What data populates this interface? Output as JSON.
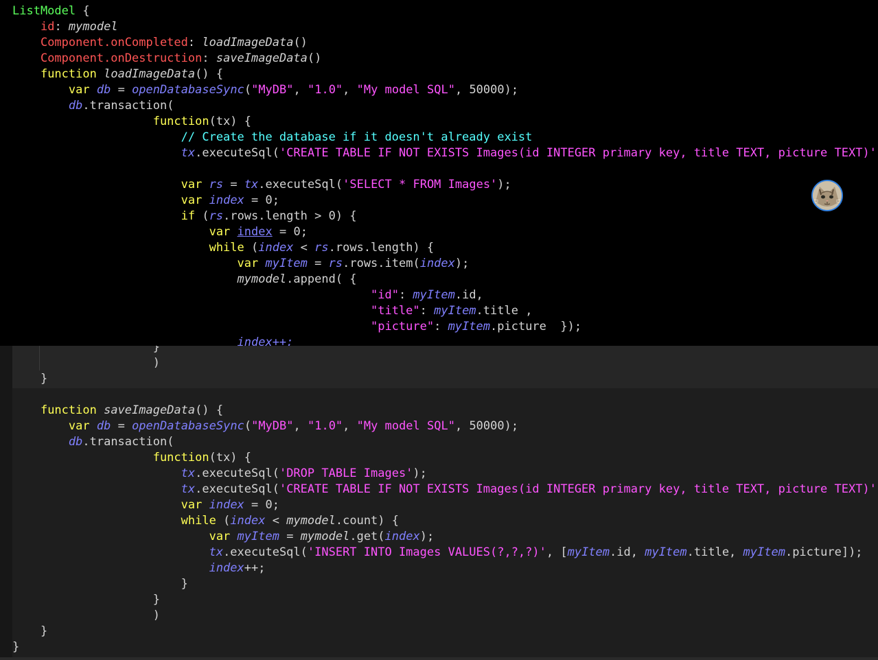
{
  "editor": {
    "top_lines": [
      [
        [
          "ListModel",
          "lg"
        ],
        [
          " {",
          "w"
        ]
      ],
      [
        [
          "    ",
          ""
        ],
        [
          "id",
          "red"
        ],
        [
          ": ",
          "w"
        ],
        [
          "mymodel",
          "w it"
        ]
      ],
      [
        [
          "    ",
          ""
        ],
        [
          "Component.onCompleted",
          "red"
        ],
        [
          ": ",
          "w"
        ],
        [
          "loadImageData",
          "w it"
        ],
        [
          "()",
          "w"
        ]
      ],
      [
        [
          "    ",
          ""
        ],
        [
          "Component.onDestruction",
          "red"
        ],
        [
          ": ",
          "w"
        ],
        [
          "saveImageData",
          "w it"
        ],
        [
          "()",
          "w"
        ]
      ],
      [
        [
          "    ",
          ""
        ],
        [
          "function",
          "kw"
        ],
        [
          " ",
          ""
        ],
        [
          "loadImageData",
          "w it"
        ],
        [
          "() {",
          "w"
        ]
      ],
      [
        [
          "        ",
          ""
        ],
        [
          "var",
          "kw"
        ],
        [
          " ",
          ""
        ],
        [
          "db",
          "prp it"
        ],
        [
          " = ",
          "w"
        ],
        [
          "openDatabaseSync",
          "prp it"
        ],
        [
          "(",
          "w"
        ],
        [
          "\"MyDB\"",
          "str"
        ],
        [
          ", ",
          "w"
        ],
        [
          "\"1.0\"",
          "str"
        ],
        [
          ", ",
          "w"
        ],
        [
          "\"My model SQL\"",
          "str"
        ],
        [
          ", ",
          "w"
        ],
        [
          "50000",
          "w"
        ],
        [
          ");",
          "w"
        ]
      ],
      [
        [
          "        ",
          ""
        ],
        [
          "db",
          "prp it"
        ],
        [
          ".transaction(",
          "w"
        ]
      ],
      [
        [
          "                    ",
          ""
        ],
        [
          "function",
          "kw"
        ],
        [
          "(tx) {",
          "w"
        ]
      ],
      [
        [
          "                        ",
          ""
        ],
        [
          "// Create the database if it doesn't already exist",
          "cm"
        ]
      ],
      [
        [
          "                        ",
          ""
        ],
        [
          "tx",
          "prp it"
        ],
        [
          ".executeSql(",
          "w"
        ],
        [
          "'CREATE TABLE IF NOT EXISTS Images(id INTEGER primary key, title TEXT, picture TEXT)'",
          "str"
        ],
        [
          ");",
          "w"
        ]
      ],
      [],
      [
        [
          "                        ",
          ""
        ],
        [
          "var",
          "kw"
        ],
        [
          " ",
          ""
        ],
        [
          "rs",
          "prp it"
        ],
        [
          " = ",
          "w"
        ],
        [
          "tx",
          "prp it"
        ],
        [
          ".executeSql(",
          "w"
        ],
        [
          "'SELECT * FROM Images'",
          "str"
        ],
        [
          ");",
          "w"
        ]
      ],
      [
        [
          "                        ",
          ""
        ],
        [
          "var",
          "kw"
        ],
        [
          " ",
          ""
        ],
        [
          "index",
          "prp it"
        ],
        [
          " = ",
          "w"
        ],
        [
          "0",
          "w"
        ],
        [
          ";",
          "w"
        ]
      ],
      [
        [
          "                        ",
          ""
        ],
        [
          "if",
          "kw"
        ],
        [
          " (",
          "w"
        ],
        [
          "rs",
          "prp it"
        ],
        [
          ".rows.length > ",
          "w"
        ],
        [
          "0",
          "w"
        ],
        [
          ") {",
          "w"
        ]
      ],
      [
        [
          "                            ",
          ""
        ],
        [
          "var",
          "kw"
        ],
        [
          " ",
          ""
        ],
        [
          "index",
          "prp ul"
        ],
        [
          " = ",
          "w"
        ],
        [
          "0",
          "w"
        ],
        [
          ";",
          "w"
        ]
      ],
      [
        [
          "                            ",
          ""
        ],
        [
          "while",
          "kw"
        ],
        [
          " (",
          "w"
        ],
        [
          "index",
          "prp it"
        ],
        [
          " < ",
          "w"
        ],
        [
          "rs",
          "prp it"
        ],
        [
          ".rows.length) {",
          "w"
        ]
      ],
      [
        [
          "                                ",
          ""
        ],
        [
          "var",
          "kw"
        ],
        [
          " ",
          ""
        ],
        [
          "myItem",
          "prp it"
        ],
        [
          " = ",
          "w"
        ],
        [
          "rs",
          "prp it"
        ],
        [
          ".rows.item(",
          "w"
        ],
        [
          "index",
          "prp it"
        ],
        [
          ");",
          "w"
        ]
      ],
      [
        [
          "                                ",
          ""
        ],
        [
          "mymodel",
          "w it"
        ],
        [
          ".append( {",
          "w"
        ]
      ],
      [
        [
          "                                                   ",
          ""
        ],
        [
          "\"id\"",
          "str"
        ],
        [
          ": ",
          "w"
        ],
        [
          "myItem",
          "prp it"
        ],
        [
          ".id,",
          "w"
        ]
      ],
      [
        [
          "                                                   ",
          ""
        ],
        [
          "\"title\"",
          "str"
        ],
        [
          ": ",
          "w"
        ],
        [
          "myItem",
          "prp it"
        ],
        [
          ".title ,",
          "w"
        ]
      ],
      [
        [
          "                                                   ",
          ""
        ],
        [
          "\"picture\"",
          "str"
        ],
        [
          ": ",
          "w"
        ],
        [
          "myItem",
          "prp it"
        ],
        [
          ".picture  });",
          "w"
        ]
      ],
      [
        [
          "                                ",
          ""
        ],
        [
          "index++;",
          "prp it"
        ]
      ]
    ],
    "bottom_lines": [
      [
        [
          "                    ",
          ""
        ],
        [
          "}",
          "w"
        ]
      ],
      [
        [
          "                    ",
          ""
        ],
        [
          ")",
          "w"
        ]
      ],
      [
        [
          "    ",
          ""
        ],
        [
          "}",
          "w"
        ]
      ],
      [],
      [
        [
          "    ",
          ""
        ],
        [
          "function",
          "kw"
        ],
        [
          " ",
          ""
        ],
        [
          "saveImageData",
          "w it"
        ],
        [
          "() {",
          "w"
        ]
      ],
      [
        [
          "        ",
          ""
        ],
        [
          "var",
          "kw"
        ],
        [
          " ",
          ""
        ],
        [
          "db",
          "prp it"
        ],
        [
          " = ",
          "w"
        ],
        [
          "openDatabaseSync",
          "prp it"
        ],
        [
          "(",
          "w"
        ],
        [
          "\"MyDB\"",
          "str"
        ],
        [
          ", ",
          "w"
        ],
        [
          "\"1.0\"",
          "str"
        ],
        [
          ", ",
          "w"
        ],
        [
          "\"My model SQL\"",
          "str"
        ],
        [
          ", ",
          "w"
        ],
        [
          "50000",
          "w"
        ],
        [
          ");",
          "w"
        ]
      ],
      [
        [
          "        ",
          ""
        ],
        [
          "db",
          "prp it"
        ],
        [
          ".transaction(",
          "w"
        ]
      ],
      [
        [
          "                    ",
          ""
        ],
        [
          "function",
          "kw"
        ],
        [
          "(tx) {",
          "w"
        ]
      ],
      [
        [
          "                        ",
          ""
        ],
        [
          "tx",
          "prp it"
        ],
        [
          ".executeSql(",
          "w"
        ],
        [
          "'DROP TABLE Images'",
          "str"
        ],
        [
          ");",
          "w"
        ]
      ],
      [
        [
          "                        ",
          ""
        ],
        [
          "tx",
          "prp it"
        ],
        [
          ".executeSql(",
          "w"
        ],
        [
          "'CREATE TABLE IF NOT EXISTS Images(id INTEGER primary key, title TEXT, picture TEXT)'",
          "str"
        ],
        [
          ");",
          "w"
        ]
      ],
      [
        [
          "                        ",
          ""
        ],
        [
          "var",
          "kw"
        ],
        [
          " ",
          ""
        ],
        [
          "index",
          "prp it"
        ],
        [
          " = ",
          "w"
        ],
        [
          "0",
          "w"
        ],
        [
          ";",
          "w"
        ]
      ],
      [
        [
          "                        ",
          ""
        ],
        [
          "while",
          "kw"
        ],
        [
          " (",
          "w"
        ],
        [
          "index",
          "prp it"
        ],
        [
          " < ",
          "w"
        ],
        [
          "mymodel",
          "w it"
        ],
        [
          ".count) {",
          "w"
        ]
      ],
      [
        [
          "                            ",
          ""
        ],
        [
          "var",
          "kw"
        ],
        [
          " ",
          ""
        ],
        [
          "myItem",
          "prp it"
        ],
        [
          " = ",
          "w"
        ],
        [
          "mymodel",
          "w it"
        ],
        [
          ".get(",
          "w"
        ],
        [
          "index",
          "prp it"
        ],
        [
          ");",
          "w"
        ]
      ],
      [
        [
          "                            ",
          ""
        ],
        [
          "tx",
          "prp it"
        ],
        [
          ".executeSql(",
          "w"
        ],
        [
          "'INSERT INTO Images VALUES(?,?,?)'",
          "str"
        ],
        [
          ", [",
          "w"
        ],
        [
          "myItem",
          "prp it"
        ],
        [
          ".id, ",
          "w"
        ],
        [
          "myItem",
          "prp it"
        ],
        [
          ".title, ",
          "w"
        ],
        [
          "myItem",
          "prp it"
        ],
        [
          ".picture]);",
          "w"
        ]
      ],
      [
        [
          "                            ",
          ""
        ],
        [
          "index",
          "prp it"
        ],
        [
          "++;",
          "w"
        ]
      ],
      [
        [
          "                        ",
          ""
        ],
        [
          "}",
          "w"
        ]
      ],
      [
        [
          "                    ",
          ""
        ],
        [
          "}",
          "w"
        ]
      ],
      [
        [
          "                    ",
          ""
        ],
        [
          ")",
          "w"
        ]
      ],
      [
        [
          "    ",
          ""
        ],
        [
          "}",
          "w"
        ]
      ],
      [
        [
          "}",
          "w"
        ]
      ]
    ]
  },
  "avatar": {
    "icon": "cat-avatar-icon",
    "ring_color": "#2f7fe0"
  },
  "colors": {
    "keyword": "#ffff55",
    "type": "#5bff5b",
    "property": "#ff5555",
    "string": "#ff55ff",
    "identifier": "#8080ff",
    "comment": "#55ffff",
    "text": "#d4d4d4"
  }
}
